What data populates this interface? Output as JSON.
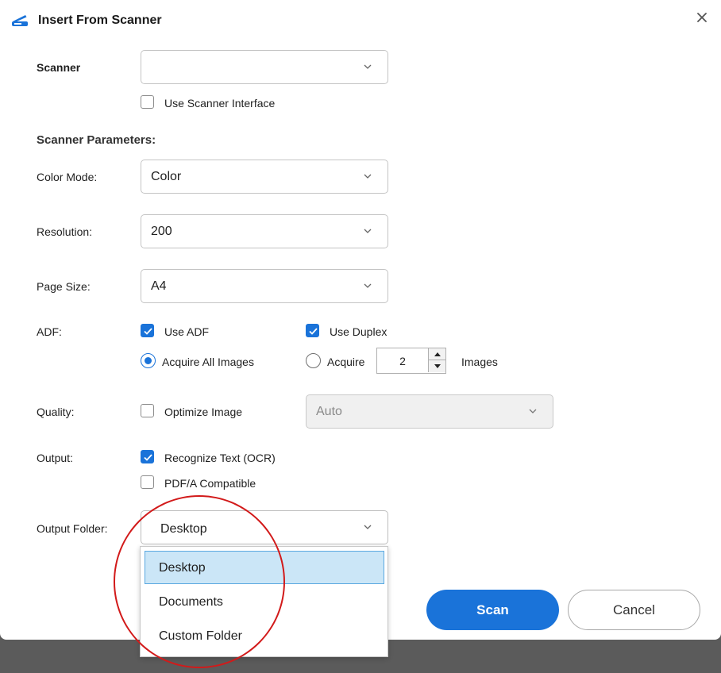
{
  "window": {
    "title": "Insert From Scanner"
  },
  "scanner": {
    "label": "Scanner",
    "value": "",
    "use_interface_label": "Use Scanner Interface",
    "use_interface_checked": false
  },
  "params": {
    "title": "Scanner Parameters:",
    "color_mode": {
      "label": "Color Mode:",
      "value": "Color"
    },
    "resolution": {
      "label": "Resolution:",
      "value": "200"
    },
    "page_size": {
      "label": "Page Size:",
      "value": "A4"
    }
  },
  "adf": {
    "label": "ADF:",
    "use_adf": {
      "label": "Use ADF",
      "checked": true
    },
    "use_duplex": {
      "label": "Use Duplex",
      "checked": true
    },
    "acquire_all": {
      "label": "Acquire All Images",
      "selected": true
    },
    "acquire": {
      "label": "Acquire",
      "selected": false,
      "count": "2",
      "suffix": "Images"
    }
  },
  "quality": {
    "label": "Quality:",
    "optimize_label": "Optimize Image",
    "optimize_checked": false,
    "level": "Auto"
  },
  "output": {
    "label": "Output:",
    "ocr": {
      "label": "Recognize Text (OCR)",
      "checked": true
    },
    "pdfa": {
      "label": "PDF/A Compatible",
      "checked": false
    }
  },
  "output_folder": {
    "label": "Output Folder:",
    "value": "Desktop",
    "options": [
      "Desktop",
      "Documents",
      "Custom Folder"
    ],
    "selected_index": 0
  },
  "buttons": {
    "scan": "Scan",
    "cancel": "Cancel"
  },
  "colors": {
    "accent": "#1a73d9",
    "annotation": "#d21a1a",
    "selected_option_bg": "#cbe6f7"
  }
}
